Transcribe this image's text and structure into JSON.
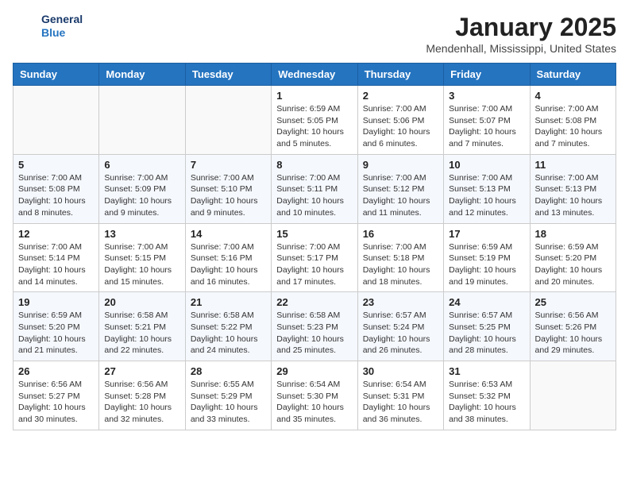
{
  "logo": {
    "line1": "General",
    "line2": "Blue"
  },
  "title": "January 2025",
  "subtitle": "Mendenhall, Mississippi, United States",
  "weekdays": [
    "Sunday",
    "Monday",
    "Tuesday",
    "Wednesday",
    "Thursday",
    "Friday",
    "Saturday"
  ],
  "weeks": [
    [
      {
        "day": "",
        "info": ""
      },
      {
        "day": "",
        "info": ""
      },
      {
        "day": "",
        "info": ""
      },
      {
        "day": "1",
        "info": "Sunrise: 6:59 AM\nSunset: 5:05 PM\nDaylight: 10 hours\nand 5 minutes."
      },
      {
        "day": "2",
        "info": "Sunrise: 7:00 AM\nSunset: 5:06 PM\nDaylight: 10 hours\nand 6 minutes."
      },
      {
        "day": "3",
        "info": "Sunrise: 7:00 AM\nSunset: 5:07 PM\nDaylight: 10 hours\nand 7 minutes."
      },
      {
        "day": "4",
        "info": "Sunrise: 7:00 AM\nSunset: 5:08 PM\nDaylight: 10 hours\nand 7 minutes."
      }
    ],
    [
      {
        "day": "5",
        "info": "Sunrise: 7:00 AM\nSunset: 5:08 PM\nDaylight: 10 hours\nand 8 minutes."
      },
      {
        "day": "6",
        "info": "Sunrise: 7:00 AM\nSunset: 5:09 PM\nDaylight: 10 hours\nand 9 minutes."
      },
      {
        "day": "7",
        "info": "Sunrise: 7:00 AM\nSunset: 5:10 PM\nDaylight: 10 hours\nand 9 minutes."
      },
      {
        "day": "8",
        "info": "Sunrise: 7:00 AM\nSunset: 5:11 PM\nDaylight: 10 hours\nand 10 minutes."
      },
      {
        "day": "9",
        "info": "Sunrise: 7:00 AM\nSunset: 5:12 PM\nDaylight: 10 hours\nand 11 minutes."
      },
      {
        "day": "10",
        "info": "Sunrise: 7:00 AM\nSunset: 5:13 PM\nDaylight: 10 hours\nand 12 minutes."
      },
      {
        "day": "11",
        "info": "Sunrise: 7:00 AM\nSunset: 5:13 PM\nDaylight: 10 hours\nand 13 minutes."
      }
    ],
    [
      {
        "day": "12",
        "info": "Sunrise: 7:00 AM\nSunset: 5:14 PM\nDaylight: 10 hours\nand 14 minutes."
      },
      {
        "day": "13",
        "info": "Sunrise: 7:00 AM\nSunset: 5:15 PM\nDaylight: 10 hours\nand 15 minutes."
      },
      {
        "day": "14",
        "info": "Sunrise: 7:00 AM\nSunset: 5:16 PM\nDaylight: 10 hours\nand 16 minutes."
      },
      {
        "day": "15",
        "info": "Sunrise: 7:00 AM\nSunset: 5:17 PM\nDaylight: 10 hours\nand 17 minutes."
      },
      {
        "day": "16",
        "info": "Sunrise: 7:00 AM\nSunset: 5:18 PM\nDaylight: 10 hours\nand 18 minutes."
      },
      {
        "day": "17",
        "info": "Sunrise: 6:59 AM\nSunset: 5:19 PM\nDaylight: 10 hours\nand 19 minutes."
      },
      {
        "day": "18",
        "info": "Sunrise: 6:59 AM\nSunset: 5:20 PM\nDaylight: 10 hours\nand 20 minutes."
      }
    ],
    [
      {
        "day": "19",
        "info": "Sunrise: 6:59 AM\nSunset: 5:20 PM\nDaylight: 10 hours\nand 21 minutes."
      },
      {
        "day": "20",
        "info": "Sunrise: 6:58 AM\nSunset: 5:21 PM\nDaylight: 10 hours\nand 22 minutes."
      },
      {
        "day": "21",
        "info": "Sunrise: 6:58 AM\nSunset: 5:22 PM\nDaylight: 10 hours\nand 24 minutes."
      },
      {
        "day": "22",
        "info": "Sunrise: 6:58 AM\nSunset: 5:23 PM\nDaylight: 10 hours\nand 25 minutes."
      },
      {
        "day": "23",
        "info": "Sunrise: 6:57 AM\nSunset: 5:24 PM\nDaylight: 10 hours\nand 26 minutes."
      },
      {
        "day": "24",
        "info": "Sunrise: 6:57 AM\nSunset: 5:25 PM\nDaylight: 10 hours\nand 28 minutes."
      },
      {
        "day": "25",
        "info": "Sunrise: 6:56 AM\nSunset: 5:26 PM\nDaylight: 10 hours\nand 29 minutes."
      }
    ],
    [
      {
        "day": "26",
        "info": "Sunrise: 6:56 AM\nSunset: 5:27 PM\nDaylight: 10 hours\nand 30 minutes."
      },
      {
        "day": "27",
        "info": "Sunrise: 6:56 AM\nSunset: 5:28 PM\nDaylight: 10 hours\nand 32 minutes."
      },
      {
        "day": "28",
        "info": "Sunrise: 6:55 AM\nSunset: 5:29 PM\nDaylight: 10 hours\nand 33 minutes."
      },
      {
        "day": "29",
        "info": "Sunrise: 6:54 AM\nSunset: 5:30 PM\nDaylight: 10 hours\nand 35 minutes."
      },
      {
        "day": "30",
        "info": "Sunrise: 6:54 AM\nSunset: 5:31 PM\nDaylight: 10 hours\nand 36 minutes."
      },
      {
        "day": "31",
        "info": "Sunrise: 6:53 AM\nSunset: 5:32 PM\nDaylight: 10 hours\nand 38 minutes."
      },
      {
        "day": "",
        "info": ""
      }
    ]
  ]
}
